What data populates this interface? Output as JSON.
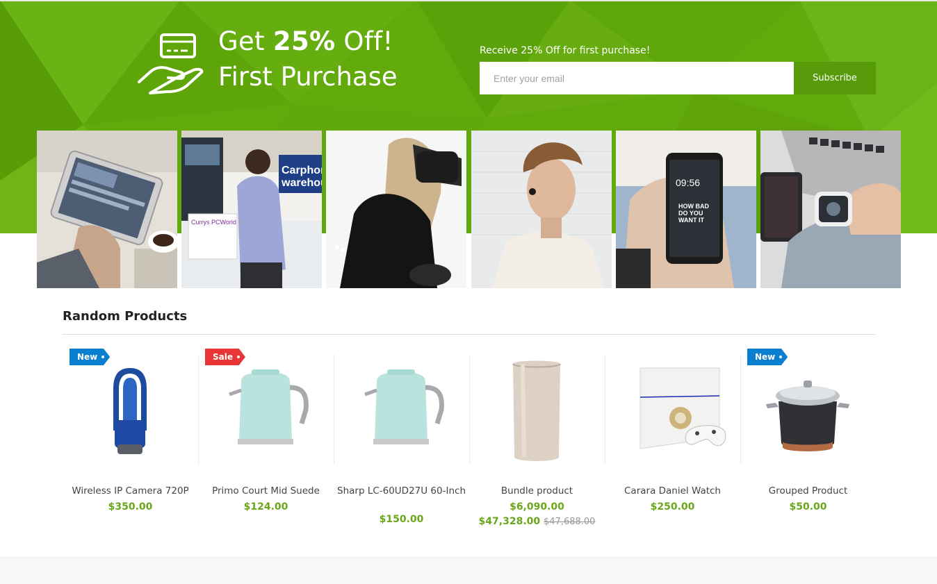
{
  "promo": {
    "headline_prefix": "Get ",
    "headline_bold": "25%",
    "headline_suffix": " Off!",
    "subheadline": "First Purchase",
    "caption": "Receive 25% Off for first purchase!",
    "email_placeholder": "Enter your email",
    "subscribe_label": "Subscribe",
    "icon": "card-in-hand-icon",
    "accent_color": "#62a90b"
  },
  "gallery": [
    {
      "name": "tablet-photo"
    },
    {
      "name": "store-customer-photo"
    },
    {
      "name": "vr-headset-photo"
    },
    {
      "name": "earbud-man-photo"
    },
    {
      "name": "smartphone-photo"
    },
    {
      "name": "smartwatch-photo"
    }
  ],
  "section": {
    "title": "Random Products"
  },
  "products": [
    {
      "name": "Wireless IP Camera 720P",
      "price": "$350.00",
      "badge": "New"
    },
    {
      "name": "Primo Court Mid Suede",
      "price": "$124.00",
      "badge": "Sale"
    },
    {
      "name": "Sharp LC-60UD27U 60-Inch",
      "price": "$150.00",
      "badge": ""
    },
    {
      "name": "Bundle product",
      "price": "$6,090.00",
      "price_sale": "$47,328.00",
      "price_old": "$47,688.00",
      "badge": ""
    },
    {
      "name": "Carara Daniel Watch",
      "price": "$250.00",
      "badge": ""
    },
    {
      "name": "Grouped Product",
      "price": "$50.00",
      "badge": "New"
    }
  ],
  "colors": {
    "price": "#6aa619",
    "badge_new": "#0a7fcf",
    "badge_sale": "#e93535"
  }
}
